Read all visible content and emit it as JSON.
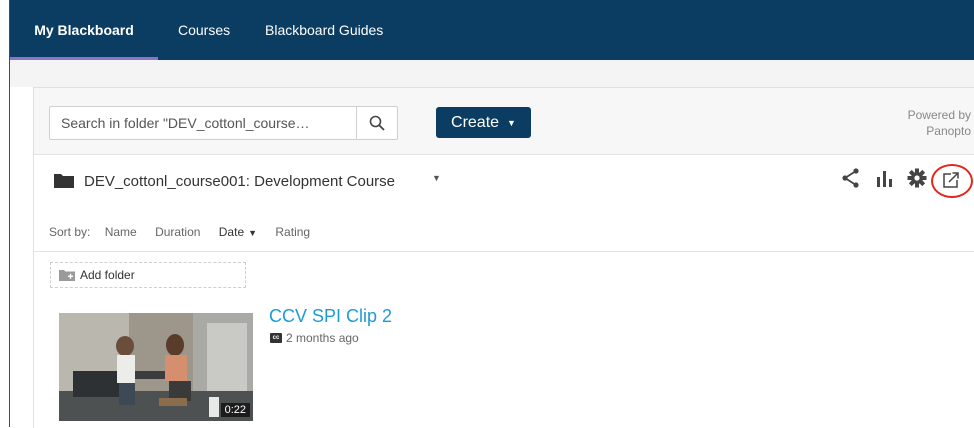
{
  "nav": {
    "items": [
      {
        "label": "My Blackboard",
        "active": true
      },
      {
        "label": "Courses",
        "active": false
      },
      {
        "label": "Blackboard Guides",
        "active": false
      }
    ],
    "background": "#0b3c61",
    "active_underline": "#8d73c9"
  },
  "toolbar": {
    "search_placeholder": "Search in folder \"DEV_cottonl_course…",
    "create_label": "Create",
    "powered_by_line1": "Powered by",
    "powered_by_line2": "Panopto"
  },
  "folder": {
    "title": "DEV_cottonl_course001: Development Course",
    "actions": [
      "share-icon",
      "stats-icon",
      "gear-icon",
      "popout-icon"
    ],
    "highlight_color": "#e0281c"
  },
  "sort": {
    "label": "Sort by:",
    "options": [
      {
        "label": "Name",
        "active": false
      },
      {
        "label": "Duration",
        "active": false
      },
      {
        "label": "Date",
        "active": true
      },
      {
        "label": "Rating",
        "active": false
      }
    ]
  },
  "add_folder_label": "Add folder",
  "session": {
    "title": "CCV SPI Clip 2",
    "cc_badge": "cc",
    "date": "2 months ago",
    "duration": "0:22",
    "title_color": "#1e9bd7"
  }
}
